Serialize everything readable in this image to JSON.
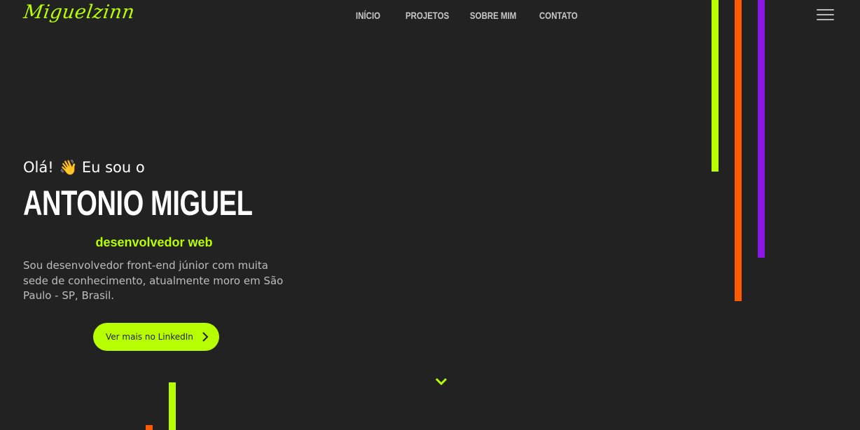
{
  "header": {
    "logo_text": "Miguelzinn",
    "nav": [
      "INÍCIO",
      "PROJETOS",
      "SOBRE MIM",
      "CONTATO"
    ],
    "menu_icon": "hamburger-menu-icon"
  },
  "hero": {
    "greeting_prefix": "Olá!",
    "wave_emoji": "👋",
    "greeting_suffix": "Eu sou o",
    "name": "ANTONIO MIGUEL",
    "role": "desenvolvedor web",
    "description": "Sou desenvolvedor front-end júnior com muita sede de conhecimento, atualmente moro em São Paulo - SP, Brasil.",
    "cta_label": "Ver mais no LinkedIn",
    "cta_icon": "chevron-right-icon",
    "scroll_icon": "chevron-down-icon"
  },
  "colors": {
    "background": "#222222",
    "accent_green": "#b7ff00",
    "accent_orange": "#ff5a00",
    "accent_purple": "#8a17e6",
    "nav_text": "#c8c8c8",
    "body_text": "#bdbdbd"
  }
}
